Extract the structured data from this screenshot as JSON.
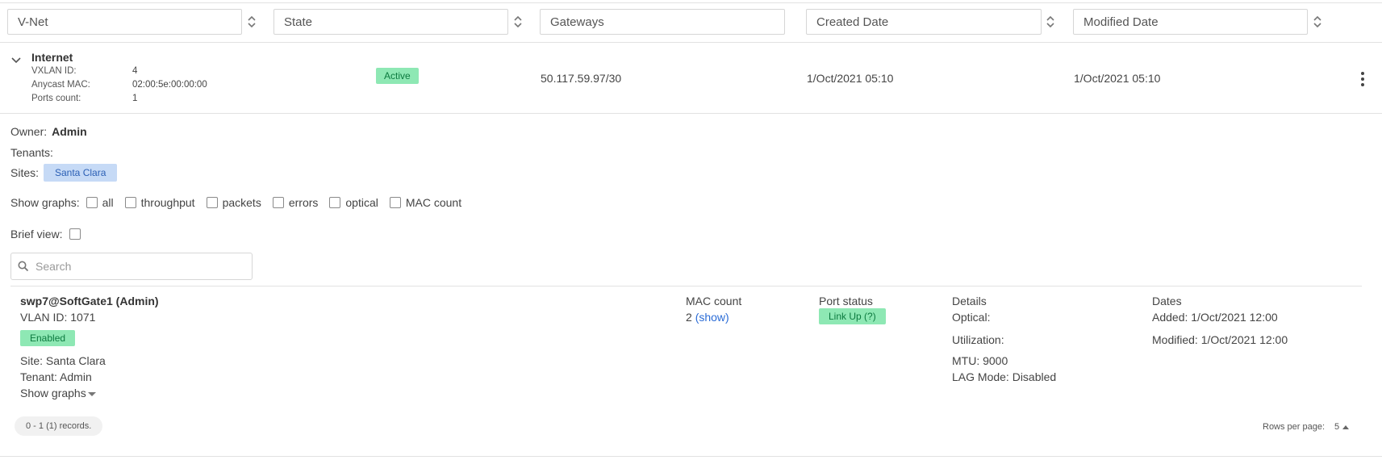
{
  "filters": {
    "vnet": "V-Net",
    "state": "State",
    "gateways": "Gateways",
    "created": "Created Date",
    "modified": "Modified Date"
  },
  "vnet_row": {
    "name": "Internet",
    "vxlan_label": "VXLAN ID:",
    "vxlan_value": "4",
    "mac_label": "Anycast MAC:",
    "mac_value": "02:00:5e:00:00:00",
    "ports_label": "Ports count:",
    "ports_value": "1",
    "state": "Active",
    "gateway": "50.117.59.97/30",
    "created": "1/Oct/2021 05:10",
    "modified": "1/Oct/2021 05:10"
  },
  "details": {
    "owner_label": "Owner:",
    "owner_value": "Admin",
    "tenants_label": "Tenants:",
    "sites_label": "Sites:",
    "site_chip": "Santa Clara",
    "graphs_label": "Show graphs:",
    "graph_options": [
      "all",
      "throughput",
      "packets",
      "errors",
      "optical",
      "MAC count"
    ],
    "brief_label": "Brief view:",
    "search_placeholder": "Search"
  },
  "port": {
    "title": "swp7@SoftGate1 (Admin)",
    "vlan": "VLAN ID: 1071",
    "status_badge": "Enabled",
    "site": "Site: Santa Clara",
    "tenant": "Tenant: Admin",
    "show_graphs": "Show graphs",
    "mac_header": "MAC count",
    "mac_count": "2",
    "mac_show": "(show)",
    "port_status_header": "Port status",
    "port_status": "Link Up (?)",
    "details_header": "Details",
    "optical": "Optical:",
    "utilization": "Utilization:",
    "mtu": "MTU: 9000",
    "lag": "LAG Mode: Disabled",
    "dates_header": "Dates",
    "added": "Added: 1/Oct/2021 12:00",
    "modified": "Modified: 1/Oct/2021 12:00"
  },
  "footer": {
    "records": "0 - 1 (1) records.",
    "rows_label": "Rows per page:",
    "rows_value": "5"
  }
}
